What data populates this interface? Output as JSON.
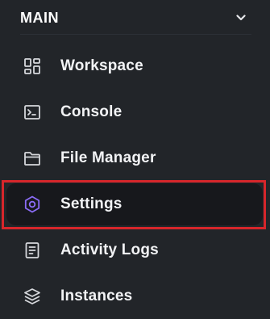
{
  "section": {
    "title": "MAIN",
    "chevron_icon": "chevron-down-icon"
  },
  "nav": {
    "items": [
      {
        "label": "Workspace",
        "icon": "grid-layout-icon",
        "active": false
      },
      {
        "label": "Console",
        "icon": "terminal-icon",
        "active": false
      },
      {
        "label": "File Manager",
        "icon": "folder-icon",
        "active": false
      },
      {
        "label": "Settings",
        "icon": "gear-icon",
        "active": true
      },
      {
        "label": "Activity Logs",
        "icon": "document-icon",
        "active": false
      },
      {
        "label": "Instances",
        "icon": "layers-icon",
        "active": false
      }
    ]
  },
  "colors": {
    "background": "#222529",
    "active_background": "#17181c",
    "text": "#f2f3f5",
    "icon": "#d6d8dc",
    "active_icon": "#8b6cf6",
    "highlight_outline": "#d7262b"
  }
}
